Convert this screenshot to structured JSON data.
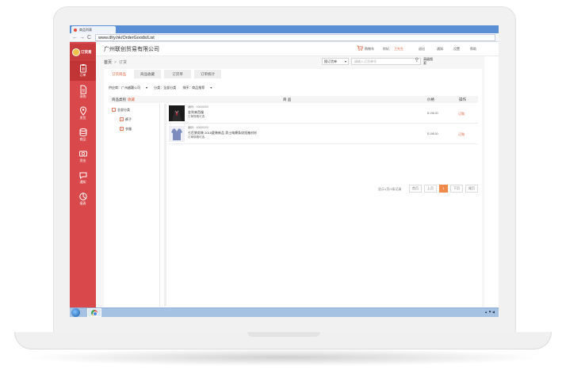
{
  "browser": {
    "tab_title": "商品列表",
    "back": "←",
    "forward": "→",
    "reload": "C",
    "url": "www.dhy.hk/OrderGoods/List"
  },
  "sidebar": {
    "logo_text": "订货易",
    "items": [
      {
        "label": "订单",
        "icon": "clipboard-icon",
        "active": true
      },
      {
        "label": "采购",
        "icon": "document-icon"
      },
      {
        "label": "发货",
        "icon": "location-pin-icon"
      },
      {
        "label": "商品",
        "icon": "database-icon"
      },
      {
        "label": "资金",
        "icon": "money-icon"
      },
      {
        "label": "通知",
        "icon": "chat-bubble-icon"
      },
      {
        "label": "报表",
        "icon": "pie-chart-icon"
      }
    ]
  },
  "header": {
    "company": "广州联创贸易有限公司",
    "cart": "购物车",
    "user_a": "你好,",
    "user_b": "王先生",
    "exit": "退出",
    "notice": "通知",
    "settings": "设置",
    "help": "帮助"
  },
  "breadcrumb": {
    "home": "首页",
    "sep": ">",
    "current": "订货"
  },
  "search": {
    "select": "搜订货单",
    "placeholder": "请输入订货单号",
    "advanced": "高级搜索"
  },
  "tabs": [
    "订货商品",
    "商品收藏",
    "订货单",
    "订单统计"
  ],
  "filters": {
    "supplier": "供应商：广州越疆公司",
    "category": "分类：全部分类",
    "sort": "排序：商品推荐"
  },
  "table": {
    "col_category": "商品类别",
    "col_category_link": "收藏",
    "col_product": "商   品",
    "col_price": "价格",
    "col_op": "操作"
  },
  "tree": {
    "root": "全部分类",
    "children": [
      "裤子",
      "衣服"
    ]
  },
  "products": [
    {
      "code": "编码：00000000",
      "name": "金利来西服",
      "spec": "订单规格可选",
      "price": "$ 198.00",
      "op": "订购"
    },
    {
      "code": "编码：00000000",
      "name": "七匹狼男装 2015夏装新品 男士纯棉条纹短袖衬衫",
      "spec": "订单规格可选",
      "price": "$ 198.00",
      "op": "订购"
    }
  ],
  "pager": {
    "total": "显示1页/1条记录",
    "first": "首页",
    "prev": "上页",
    "current": "1",
    "next": "下页",
    "last": "尾页"
  },
  "colors": {
    "sidebar": "#d9494b",
    "accent": "#e05d3a",
    "pager_active": "#f08a4b"
  }
}
